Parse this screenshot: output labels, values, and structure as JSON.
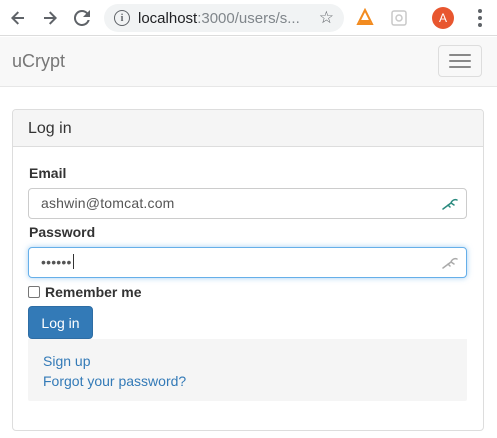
{
  "browser": {
    "url_host": "localhost",
    "url_rest": ":3000/users/s...",
    "profile_initial": "A"
  },
  "navbar": {
    "brand": "uCrypt"
  },
  "panel": {
    "title": "Log in"
  },
  "form": {
    "email_label": "Email",
    "email_value": "ashwin@tomcat.com",
    "password_label": "Password",
    "password_value": "••••••",
    "remember_label": "Remember me",
    "remember_checked": false,
    "submit_label": "Log in"
  },
  "links": {
    "sign_up": "Sign up",
    "forgot_password": "Forgot your password?"
  },
  "colors": {
    "primary": "#337ab7",
    "navbar_bg": "#f8f8f8",
    "panel_heading_bg": "#f5f5f5",
    "focus_border": "#66afe9",
    "avatar_bg": "#e8562f"
  },
  "icons": {
    "back": "arrow-left-icon",
    "forward": "arrow-right-icon",
    "reload": "reload-icon",
    "info": "info-icon",
    "bookmark": "star-icon",
    "extension_1": "extension-icon",
    "extension_2": "extension-icon",
    "menu": "more-vert-icon",
    "navbar_toggle": "hamburger-icon",
    "password_manager": "key-icon"
  }
}
